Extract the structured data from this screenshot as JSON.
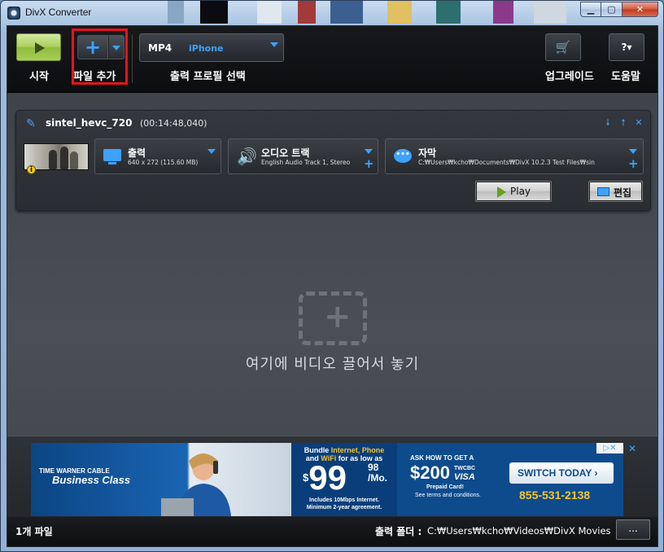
{
  "window": {
    "title": "DivX Converter"
  },
  "toolbar": {
    "start_label": "시작",
    "add_file_label": "파일 추가",
    "profile_format": "MP4",
    "profile_device": "iPhone",
    "profile_label": "출력 프로필 선택",
    "upgrade_label": "업그레이드",
    "help_label": "도움말",
    "help_button": "?▾"
  },
  "file": {
    "name": "sintel_hevc_720",
    "duration": "(00:14:48,040)",
    "output": {
      "title": "출력",
      "detail": "640 x 272 (115.60 MB)"
    },
    "audio": {
      "title": "오디오 트랙",
      "detail": "English Audio Track 1, Stereo"
    },
    "subtitle": {
      "title": "자막",
      "detail": "C:₩Users₩kcho₩Documents₩DivX 10.2.3 Test Files₩sin"
    },
    "play_label": "Play",
    "edit_label": "편집"
  },
  "drop_zone": {
    "text": "여기에 비디오 끌어서 놓기"
  },
  "ad": {
    "logo_line1": "TIME WARNER CABLE",
    "logo_line2": "Business Class",
    "bundle_line1": "Bundle",
    "bundle_highlight1": "Internet, Phone",
    "bundle_line2": "and",
    "bundle_highlight2": "WiFi",
    "bundle_line3": "for as low as",
    "price_dollar": "$",
    "price_main": "99",
    "price_cents": "98",
    "price_unit": "/Mo.",
    "fine1": "Includes 10Mbps Internet.",
    "fine2": "Minimum 2-year agreement.",
    "ask": "ASK HOW TO GET A",
    "offer": "$200",
    "twcbc": "TWCBC",
    "visa": "VISA",
    "prepaid": "Prepaid Card!",
    "terms": "See terms and conditions.",
    "switch": "SWITCH TODAY",
    "phone": "855-531-2138"
  },
  "status": {
    "file_count": "1개 파일",
    "output_folder_label": "출력 폴더 :",
    "output_folder_path": "C:₩Users₩kcho₩Videos₩DivX Movies",
    "browse_label": "..."
  },
  "colors": {
    "accent": "#3ea2ff",
    "highlight": "#e5141b",
    "start_green": "#a9cf5c"
  }
}
